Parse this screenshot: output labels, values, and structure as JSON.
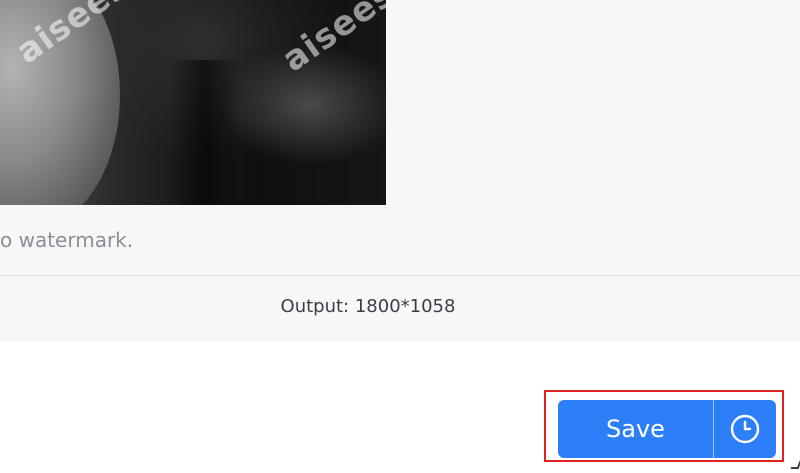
{
  "preview": {
    "watermark_text": "aiseesoft",
    "note": "o watermark."
  },
  "output": {
    "label": "Output: 1800*1058"
  },
  "actions": {
    "save_label": "Save",
    "schedule_icon": "clock-icon"
  },
  "colors": {
    "accent": "#2d7ff9",
    "highlight": "#e02020",
    "panel_bg": "#f7f7f8"
  }
}
